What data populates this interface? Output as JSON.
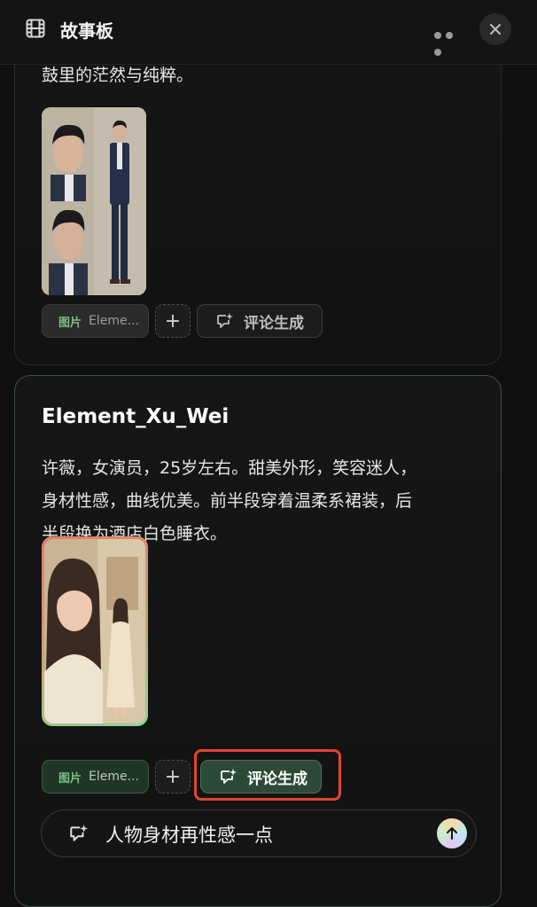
{
  "header": {
    "title": "故事板",
    "film_icon": "film-icon",
    "more_icon": "more-horizontal-icon",
    "close_icon": "close-icon"
  },
  "cards": [
    {
      "description_tail": "鼓里的茫然与纯粹。",
      "image_alt": "character reference sheet",
      "tag": {
        "label": "图片",
        "value": "Eleme..."
      },
      "add_label": "+",
      "generate_label": "评论生成"
    },
    {
      "name": "Element_Xu_Wei",
      "description_lines": [
        "许薇，女演员，25岁左右。甜美外形，笑容迷人，",
        "身材性感，曲线优美。前半段穿着温柔系裙装，后",
        "半段换为酒店白色睡衣。"
      ],
      "image_alt": "character reference sheet",
      "tag": {
        "label": "图片",
        "value": "Eleme..."
      },
      "add_label": "+",
      "generate_label": "评论生成"
    }
  ],
  "input": {
    "value": "人物身材再性感一点",
    "icon": "comment-sparkle-icon",
    "send_icon": "arrow-up-icon"
  },
  "colors": {
    "highlight": "#e2462f",
    "accent_green": "#2d4a37",
    "background": "#101010"
  }
}
